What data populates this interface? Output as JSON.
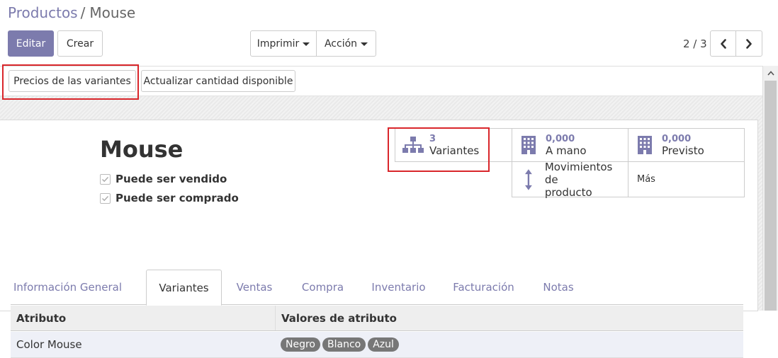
{
  "breadcrumb": {
    "parent": "Productos",
    "separator": "/",
    "current": "Mouse"
  },
  "buttons": {
    "edit": "Editar",
    "create": "Crear",
    "print": "Imprimir",
    "action": "Acción"
  },
  "pager": {
    "value": "2 / 3"
  },
  "statusbar": {
    "variant_prices": "Precios de las variantes",
    "update_qty": "Actualizar cantidad disponible"
  },
  "product": {
    "name": "Mouse",
    "can_be_sold": "Puede ser vendido",
    "can_be_purchased": "Puede ser comprado"
  },
  "smart_buttons": {
    "variants": {
      "value": "3",
      "label": "Variantes"
    },
    "on_hand": {
      "value": "0,000",
      "label": "A mano"
    },
    "forecasted": {
      "value": "0,000",
      "label": "Previsto"
    },
    "moves": {
      "label_line1": "Movimientos de",
      "label_line2": "producto"
    },
    "more": {
      "label": "Más"
    }
  },
  "tabs": [
    "Información General",
    "Variantes",
    "Ventas",
    "Compra",
    "Inventario",
    "Facturación",
    "Notas"
  ],
  "active_tab": "Variantes",
  "attribute_table": {
    "headers": {
      "attribute": "Atributo",
      "values": "Valores de atributo"
    },
    "rows": [
      {
        "attribute": "Color Mouse",
        "values": [
          "Negro",
          "Blanco",
          "Azul"
        ]
      }
    ]
  },
  "colors": {
    "accent": "#7c7bad",
    "highlight": "#d9262b",
    "tag": "#777777"
  },
  "icons": {
    "variants": "sitemap-icon",
    "on_hand": "building-icon",
    "forecasted": "building-icon",
    "moves": "arrows-v-icon",
    "prev": "chevron-left-icon",
    "next": "chevron-right-icon",
    "checkbox": "check-icon",
    "scroll_up": "caret-up-icon"
  }
}
